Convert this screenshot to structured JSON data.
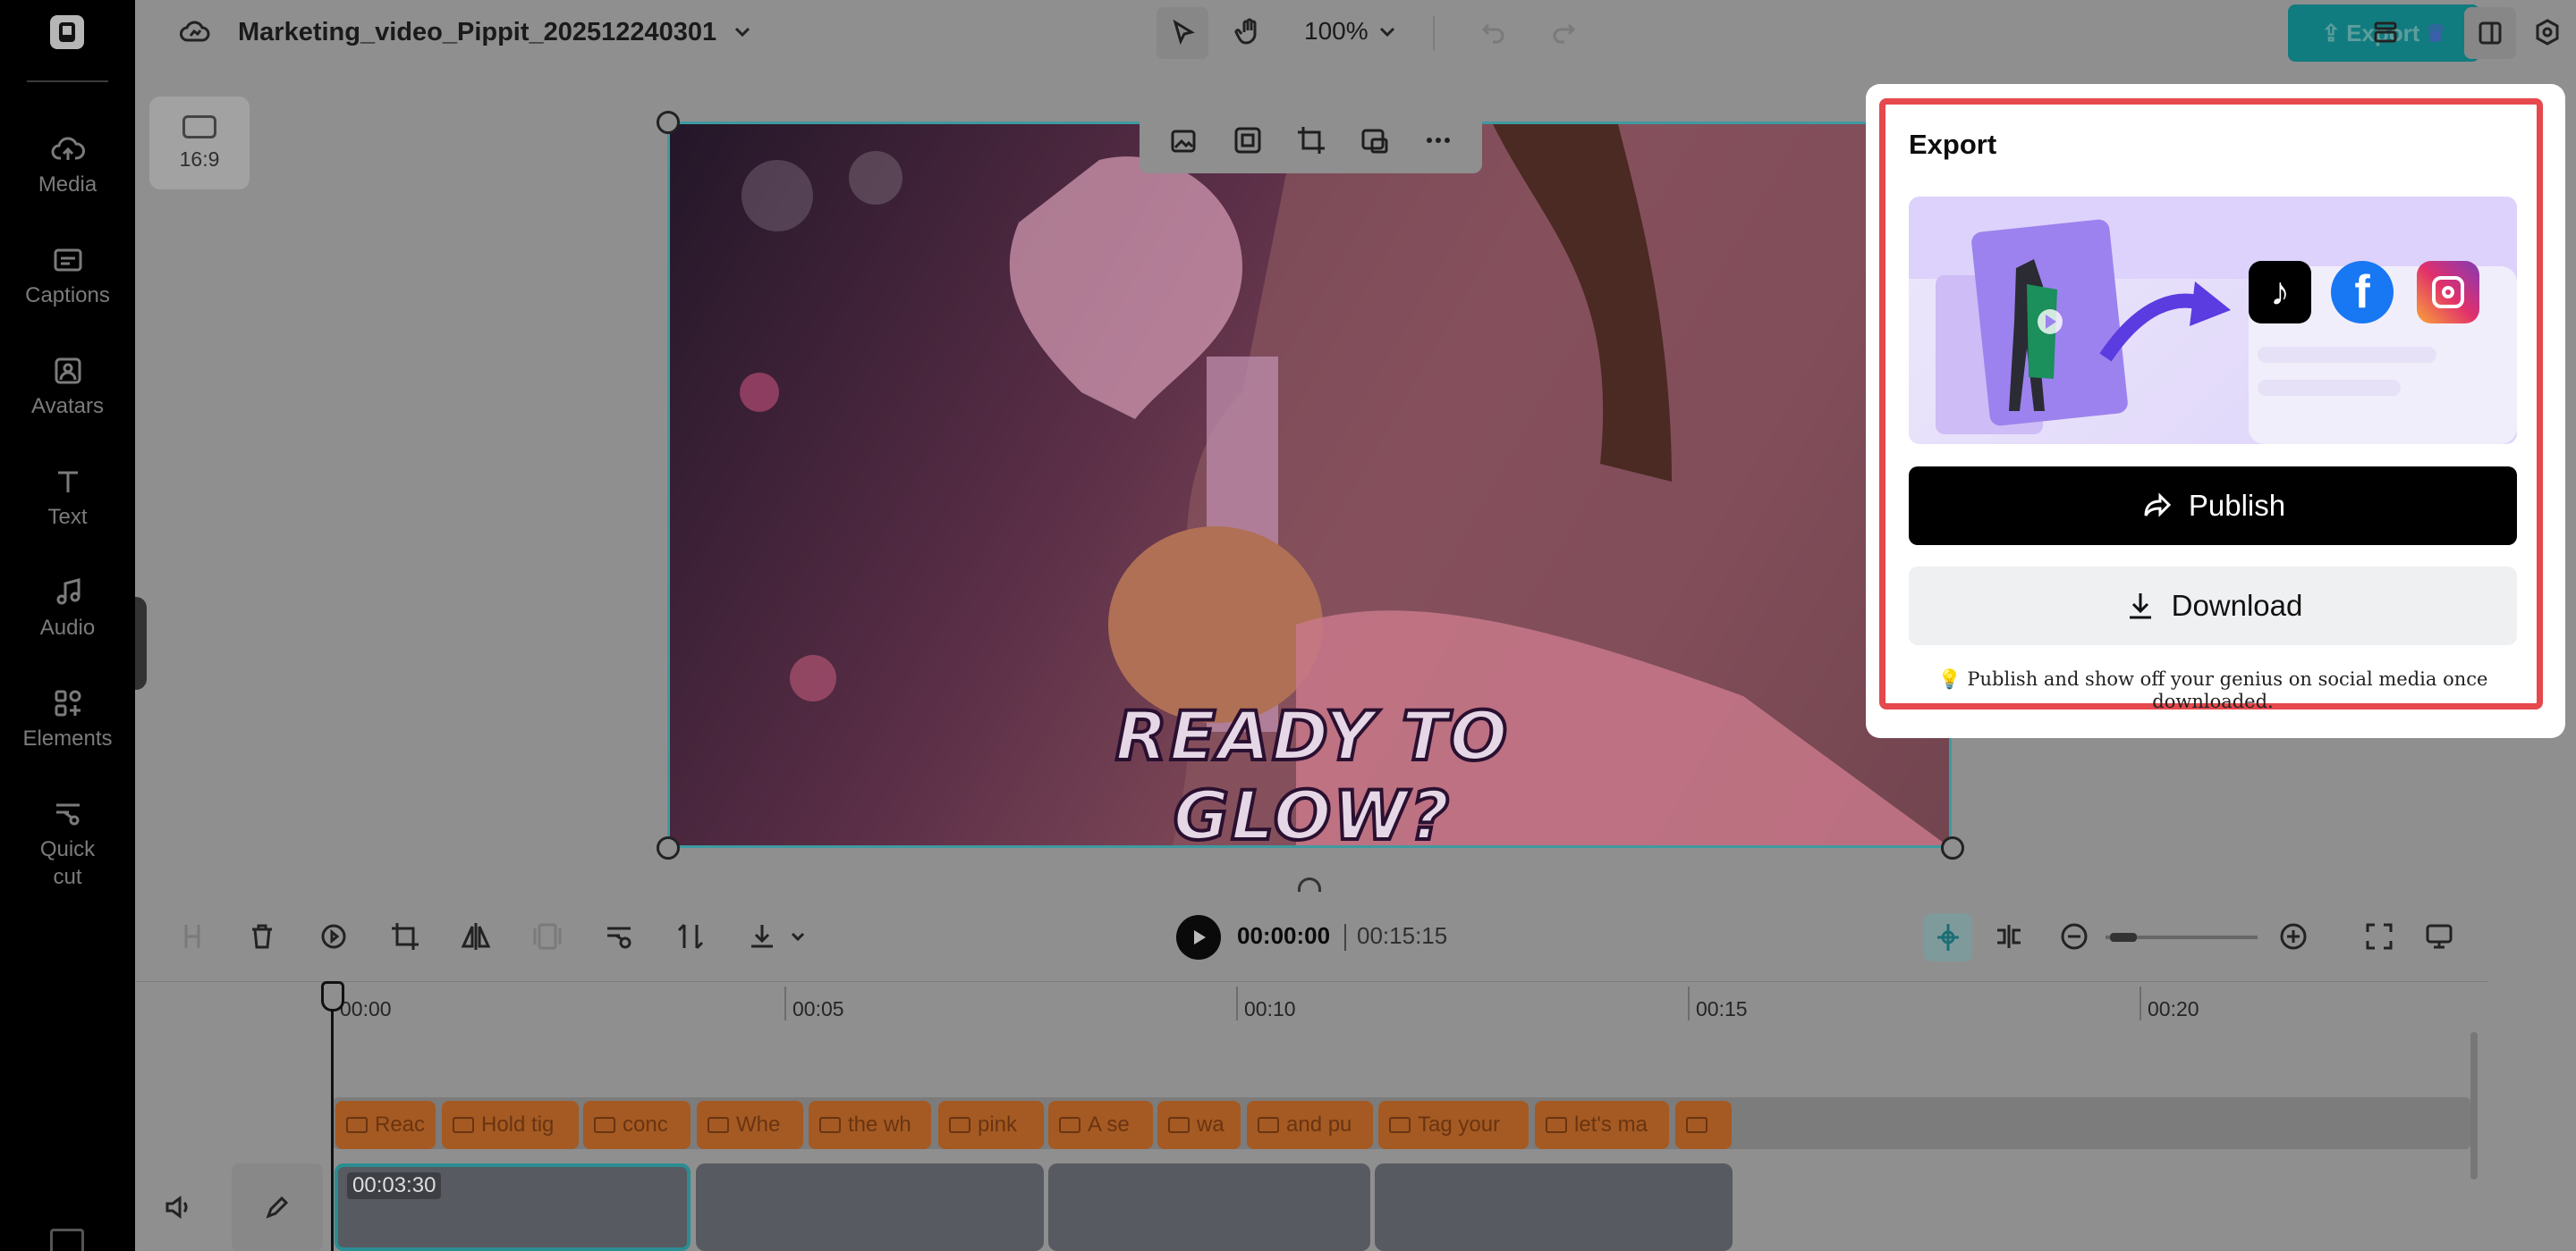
{
  "app": {
    "title": "Marketing_video_Pippit_202512240301",
    "zoom": "100%",
    "export_label": "Export"
  },
  "sidebar": {
    "items": [
      {
        "label": "Media",
        "icon": "cloud-upload-icon"
      },
      {
        "label": "Captions",
        "icon": "captions-icon"
      },
      {
        "label": "Avatars",
        "icon": "avatar-icon"
      },
      {
        "label": "Text",
        "icon": "text-icon"
      },
      {
        "label": "Audio",
        "icon": "music-note-icon"
      },
      {
        "label": "Elements",
        "icon": "elements-icon"
      },
      {
        "label": "Quick cut",
        "icon": "quick-cut-icon"
      }
    ]
  },
  "canvas": {
    "aspect_ratio": "16:9",
    "video_caption": "READY TO GLOW?"
  },
  "timeline": {
    "current_time": "00:00:00",
    "total_time": "00:15:15",
    "ruler_labels": [
      "00:00",
      "00:05",
      "00:10",
      "00:15",
      "00:20"
    ],
    "caption_clips": [
      "Reac",
      "Hold tig",
      "conc",
      "Whe",
      "the wh",
      "pink",
      "A se",
      "wa",
      "and pu",
      "Tag your",
      "let's ma",
      ""
    ],
    "video_clip_duration": "00:03:30"
  },
  "export_panel": {
    "title": "Export",
    "publish_label": "Publish",
    "download_label": "Download",
    "hint": "💡 Publish and show off your genius on social media once downloaded.",
    "social_icons": [
      "tiktok-icon",
      "facebook-icon",
      "instagram-icon"
    ]
  },
  "colors": {
    "accent": "#117c7f",
    "highlight_frame": "#e5484d",
    "caption_clip": "#a45a22"
  }
}
